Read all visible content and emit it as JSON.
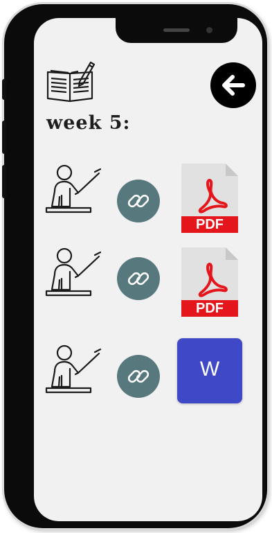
{
  "header": {
    "week_title": "week 5:"
  },
  "icons": {
    "book": "book-pen-icon",
    "back": "arrow-left-icon",
    "teacher": "teacher-at-board-icon",
    "link": "link-chain-icon"
  },
  "materials": [
    {
      "type": "pdf",
      "label": "PDF"
    },
    {
      "type": "pdf",
      "label": "PDF"
    },
    {
      "type": "word",
      "label": "W"
    }
  ],
  "colors": {
    "link_button": "#57797d",
    "pdf_red": "#e4151b",
    "word_blue": "#3f48c6",
    "back_button": "#000000"
  }
}
